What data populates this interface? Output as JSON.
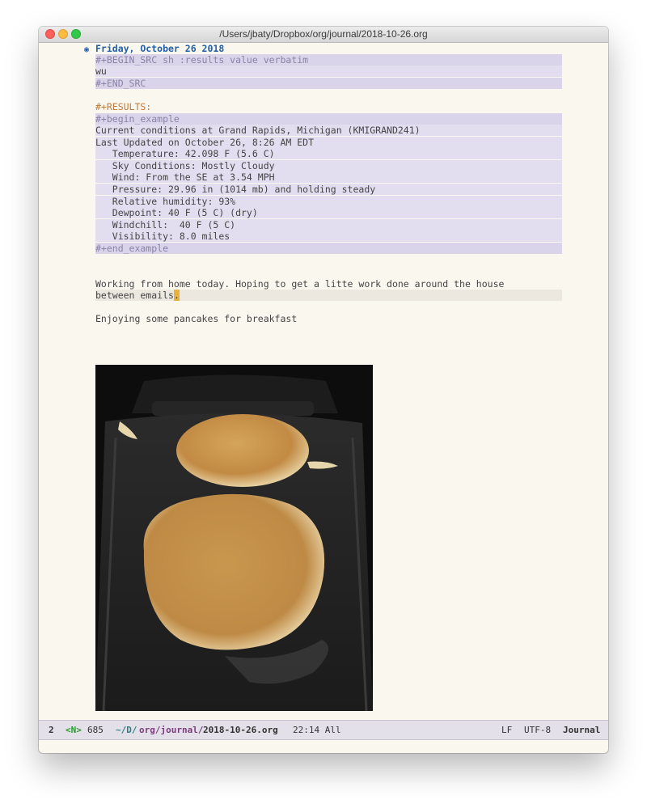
{
  "window": {
    "title": "/Users/jbaty/Dropbox/org/journal/2018-10-26.org"
  },
  "doc": {
    "heading": "Friday, October 26 2018",
    "src_begin": "#+BEGIN_SRC sh :results value verbatim",
    "src_body": "wu",
    "src_end": "#+END_SRC",
    "results_label": "#+RESULTS:",
    "example_begin": "#+begin_example",
    "example_lines": [
      "Current conditions at Grand Rapids, Michigan (KMIGRAND241)",
      "Last Updated on October 26, 8:26 AM EDT",
      "   Temperature: 42.098 F (5.6 C)",
      "   Sky Conditions: Mostly Cloudy",
      "   Wind: From the SE at 3.54 MPH",
      "   Pressure: 29.96 in (1014 mb) and holding steady",
      "   Relative humidity: 93%",
      "   Dewpoint: 40 F (5 C) (dry)",
      "   Windchill:  40 F (5 C)",
      "   Visibility: 8.0 miles"
    ],
    "example_end": "#+end_example",
    "para1_line1": "Working from home today. Hoping to get a litte work done around the house",
    "para1_line2": "between emails",
    "cursor_char": ".",
    "para2": "Enjoying some pancakes for breakfast",
    "tilde": "~"
  },
  "modeline": {
    "window_num": "2",
    "evil_state": "<N>",
    "size": "685",
    "path_prefix": "~/D/",
    "path_dir": "org/journal/",
    "path_file": "2018-10-26.org",
    "position": "22:14 All",
    "eol": "LF",
    "encoding": "UTF-8",
    "mode": "Journal"
  }
}
